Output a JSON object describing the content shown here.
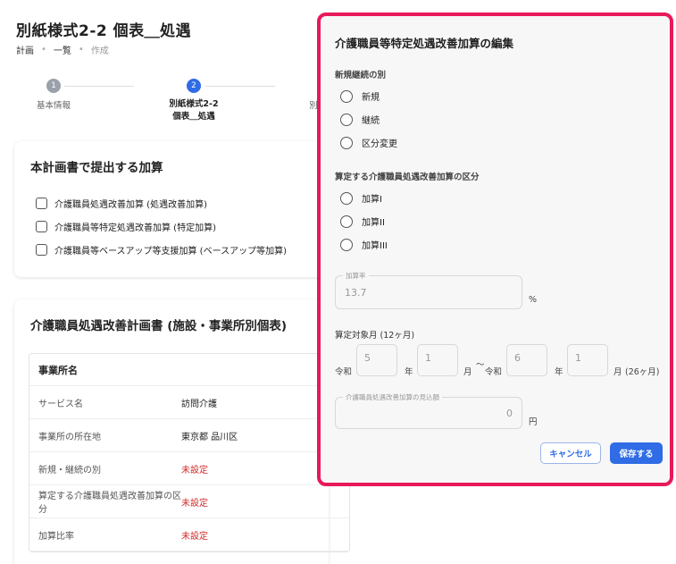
{
  "page": {
    "title": "別紙様式2-2 個表＿処遇",
    "breadcrumb": [
      "計画",
      "一覧",
      "作成"
    ]
  },
  "stepper": [
    {
      "num": "1",
      "label": "基本情報"
    },
    {
      "num": "2",
      "label": "別紙様式2-2\n個表＿処遇"
    },
    {
      "num": "",
      "label": "別"
    }
  ],
  "card1": {
    "title": "本計画書で提出する加算",
    "items": [
      "介護職員処遇改善加算 (処遇改善加算)",
      "介護職員等特定処遇改善加算 (特定加算)",
      "介護職員等ベースアップ等支援加算 (ベースアップ等加算)"
    ]
  },
  "card2": {
    "title": "介護職員処遇改善計画書 (施設・事業所別個表)",
    "table_header": "事業所名",
    "rows": [
      {
        "key": "サービス名",
        "value": "訪問介護",
        "status": "normal"
      },
      {
        "key": "事業所の所在地",
        "value": "東京都 品川区",
        "status": "normal"
      },
      {
        "key": "新規・継続の別",
        "value": "未設定",
        "status": "unset"
      },
      {
        "key": "算定する介護職員処遇改善加算の区分",
        "value": "未設定",
        "status": "unset"
      },
      {
        "key": "加算比率",
        "value": "未設定",
        "status": "unset"
      }
    ]
  },
  "modal": {
    "title": "介護職員等特定処遇改善加算の編集",
    "section1_label": "新規継続の別",
    "section1_options": [
      "新規",
      "継続",
      "区分変更"
    ],
    "section2_label": "算定する介護職員処遇改善加算の区分",
    "section2_options": [
      "加算I",
      "加算II",
      "加算III"
    ],
    "rate": {
      "legend": "加算率",
      "value": "13.7",
      "unit": "%"
    },
    "period": {
      "label": "算定対象月 (12ヶ月)",
      "era1": "令和",
      "year1": "5",
      "year_unit": "年",
      "month1": "1",
      "month_unit": "月",
      "tilde": "〜",
      "era2": "令和",
      "year2": "6",
      "month2": "1",
      "total": "(26ヶ月)"
    },
    "estimate": {
      "legend": "介護職員処遇改善加算の見込額",
      "value": "0",
      "unit": "円"
    },
    "cancel_label": "キャンセル",
    "save_label": "保存する"
  }
}
